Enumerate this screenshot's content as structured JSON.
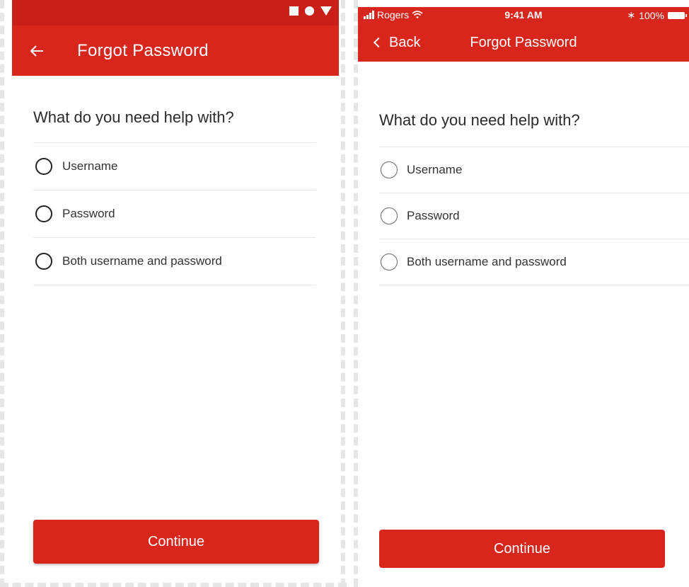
{
  "colors": {
    "brand_red": "#d9261c",
    "status_red": "#c81f17"
  },
  "android": {
    "status_icons": [
      "square-icon",
      "circle-icon",
      "triangle-icon"
    ],
    "back_icon": "arrow-left-icon",
    "title": "Forgot Password",
    "question": "What do you need help with?",
    "options": [
      {
        "label": "Username",
        "selected": false
      },
      {
        "label": "Password",
        "selected": false
      },
      {
        "label": "Both username and password",
        "selected": false
      }
    ],
    "continue_label": "Continue"
  },
  "ios": {
    "status": {
      "carrier": "Rogers",
      "time": "9:41 AM",
      "battery": "100%"
    },
    "back_label": "Back",
    "title": "Forgot Password",
    "question": "What do you need help with?",
    "options": [
      {
        "label": "Username",
        "selected": false
      },
      {
        "label": "Password",
        "selected": false
      },
      {
        "label": "Both username and password",
        "selected": false
      }
    ],
    "continue_label": "Continue"
  }
}
